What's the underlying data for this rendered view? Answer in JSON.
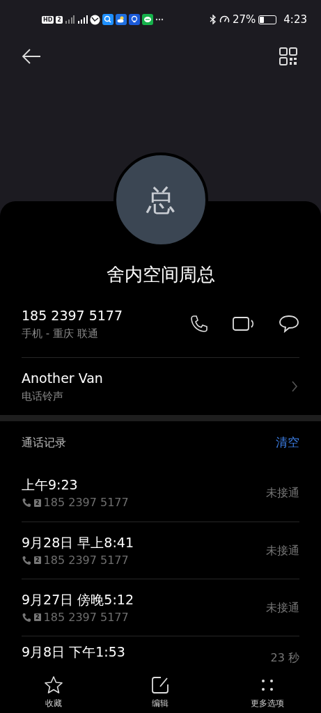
{
  "status_bar": {
    "left_badges": [
      "HD",
      "2"
    ],
    "battery_percent": "27%",
    "time": "4:23"
  },
  "contact": {
    "avatar_letter": "总",
    "name": "舍内空间周总"
  },
  "phone": {
    "number": "185 2397 5177",
    "label": "手机 - 重庆 联通"
  },
  "ringtone": {
    "value": "Another Van",
    "label": "电话铃声"
  },
  "call_log": {
    "title": "通话记录",
    "clear": "清空",
    "entries": [
      {
        "time": "上午9:23",
        "sim": "2",
        "number": "185 2397 5177",
        "result": "未接通"
      },
      {
        "time": "9月28日 早上8:41",
        "sim": "2",
        "number": "185 2397 5177",
        "result": "未接通"
      },
      {
        "time": "9月27日 傍晚5:12",
        "sim": "2",
        "number": "185 2397 5177",
        "result": "未接通"
      },
      {
        "time": "9月8日 下午1:53",
        "result": "23 秒"
      }
    ]
  },
  "bottom_bar": [
    {
      "kind": "star",
      "label": "收藏"
    },
    {
      "kind": "edit",
      "label": "编辑"
    },
    {
      "kind": "more",
      "label": "更多选项"
    }
  ]
}
